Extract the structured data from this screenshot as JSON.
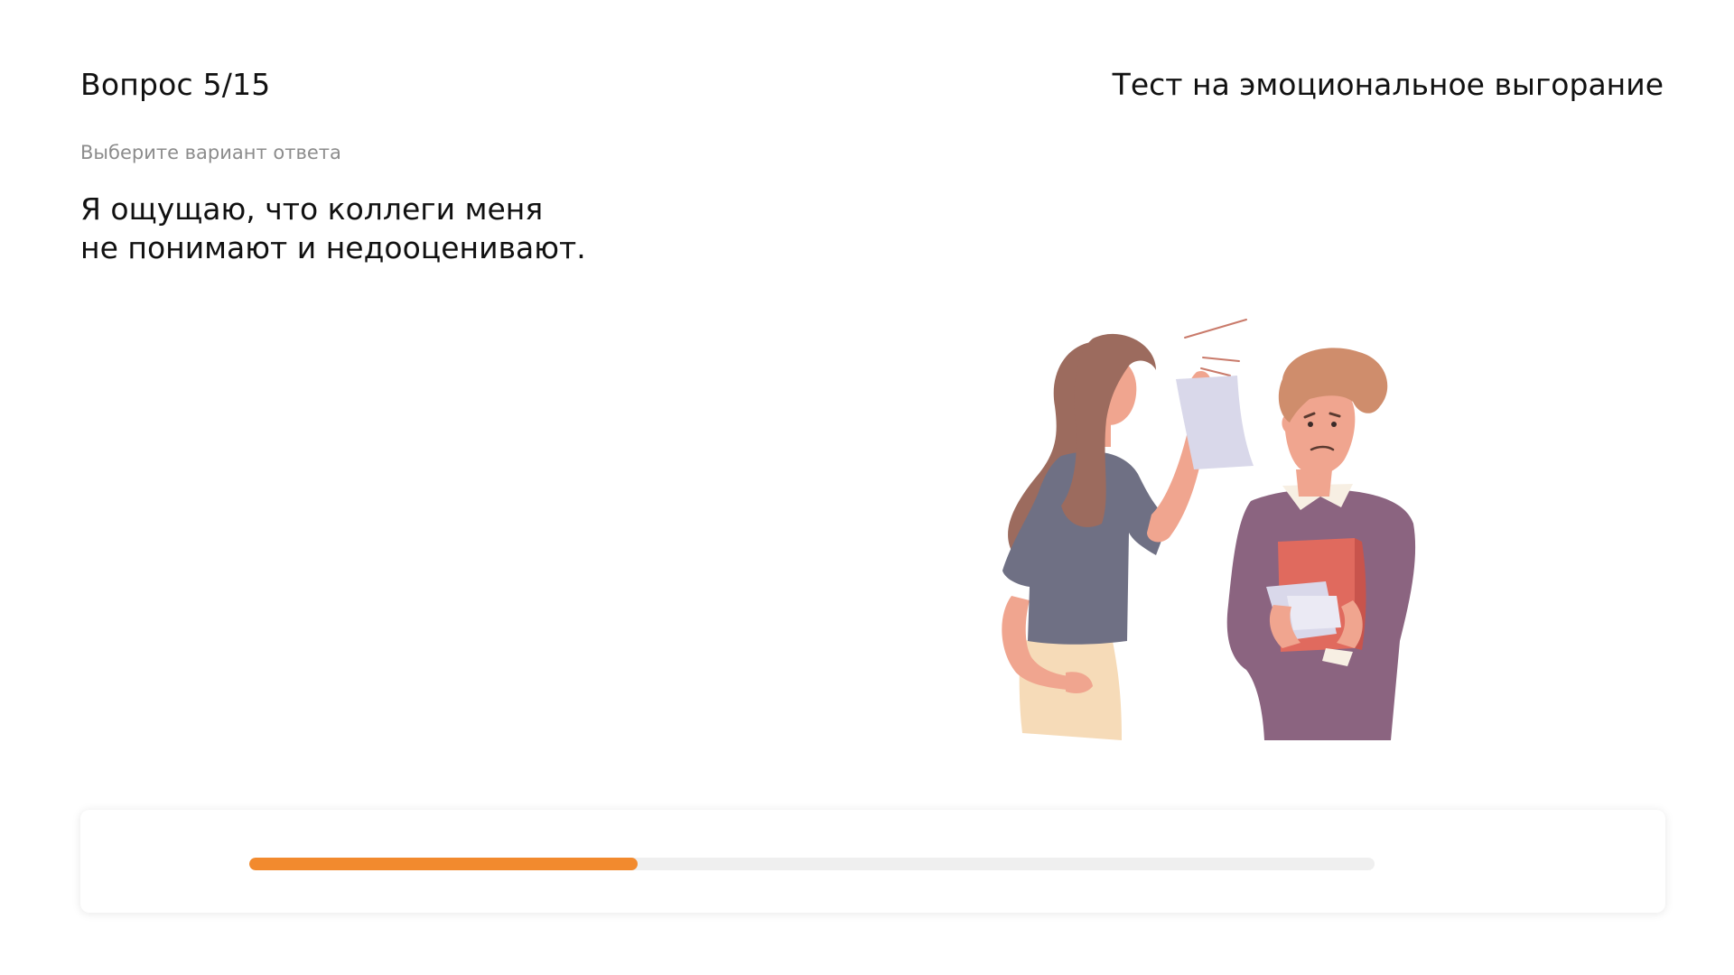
{
  "header": {
    "question_counter": "Вопрос 5/15",
    "test_title": "Тест на эмоциональное выгорание"
  },
  "main": {
    "hint": "Выберите вариант ответа",
    "question_lines": [
      "Я ощущаю, что коллеги меня",
      "не понимают и недооценивают."
    ],
    "illustration": "woman-scolding-colleague-illustration"
  },
  "progress": {
    "fraction": 0.345,
    "accent_color": "#f28a2e",
    "track_color": "#efefef"
  }
}
